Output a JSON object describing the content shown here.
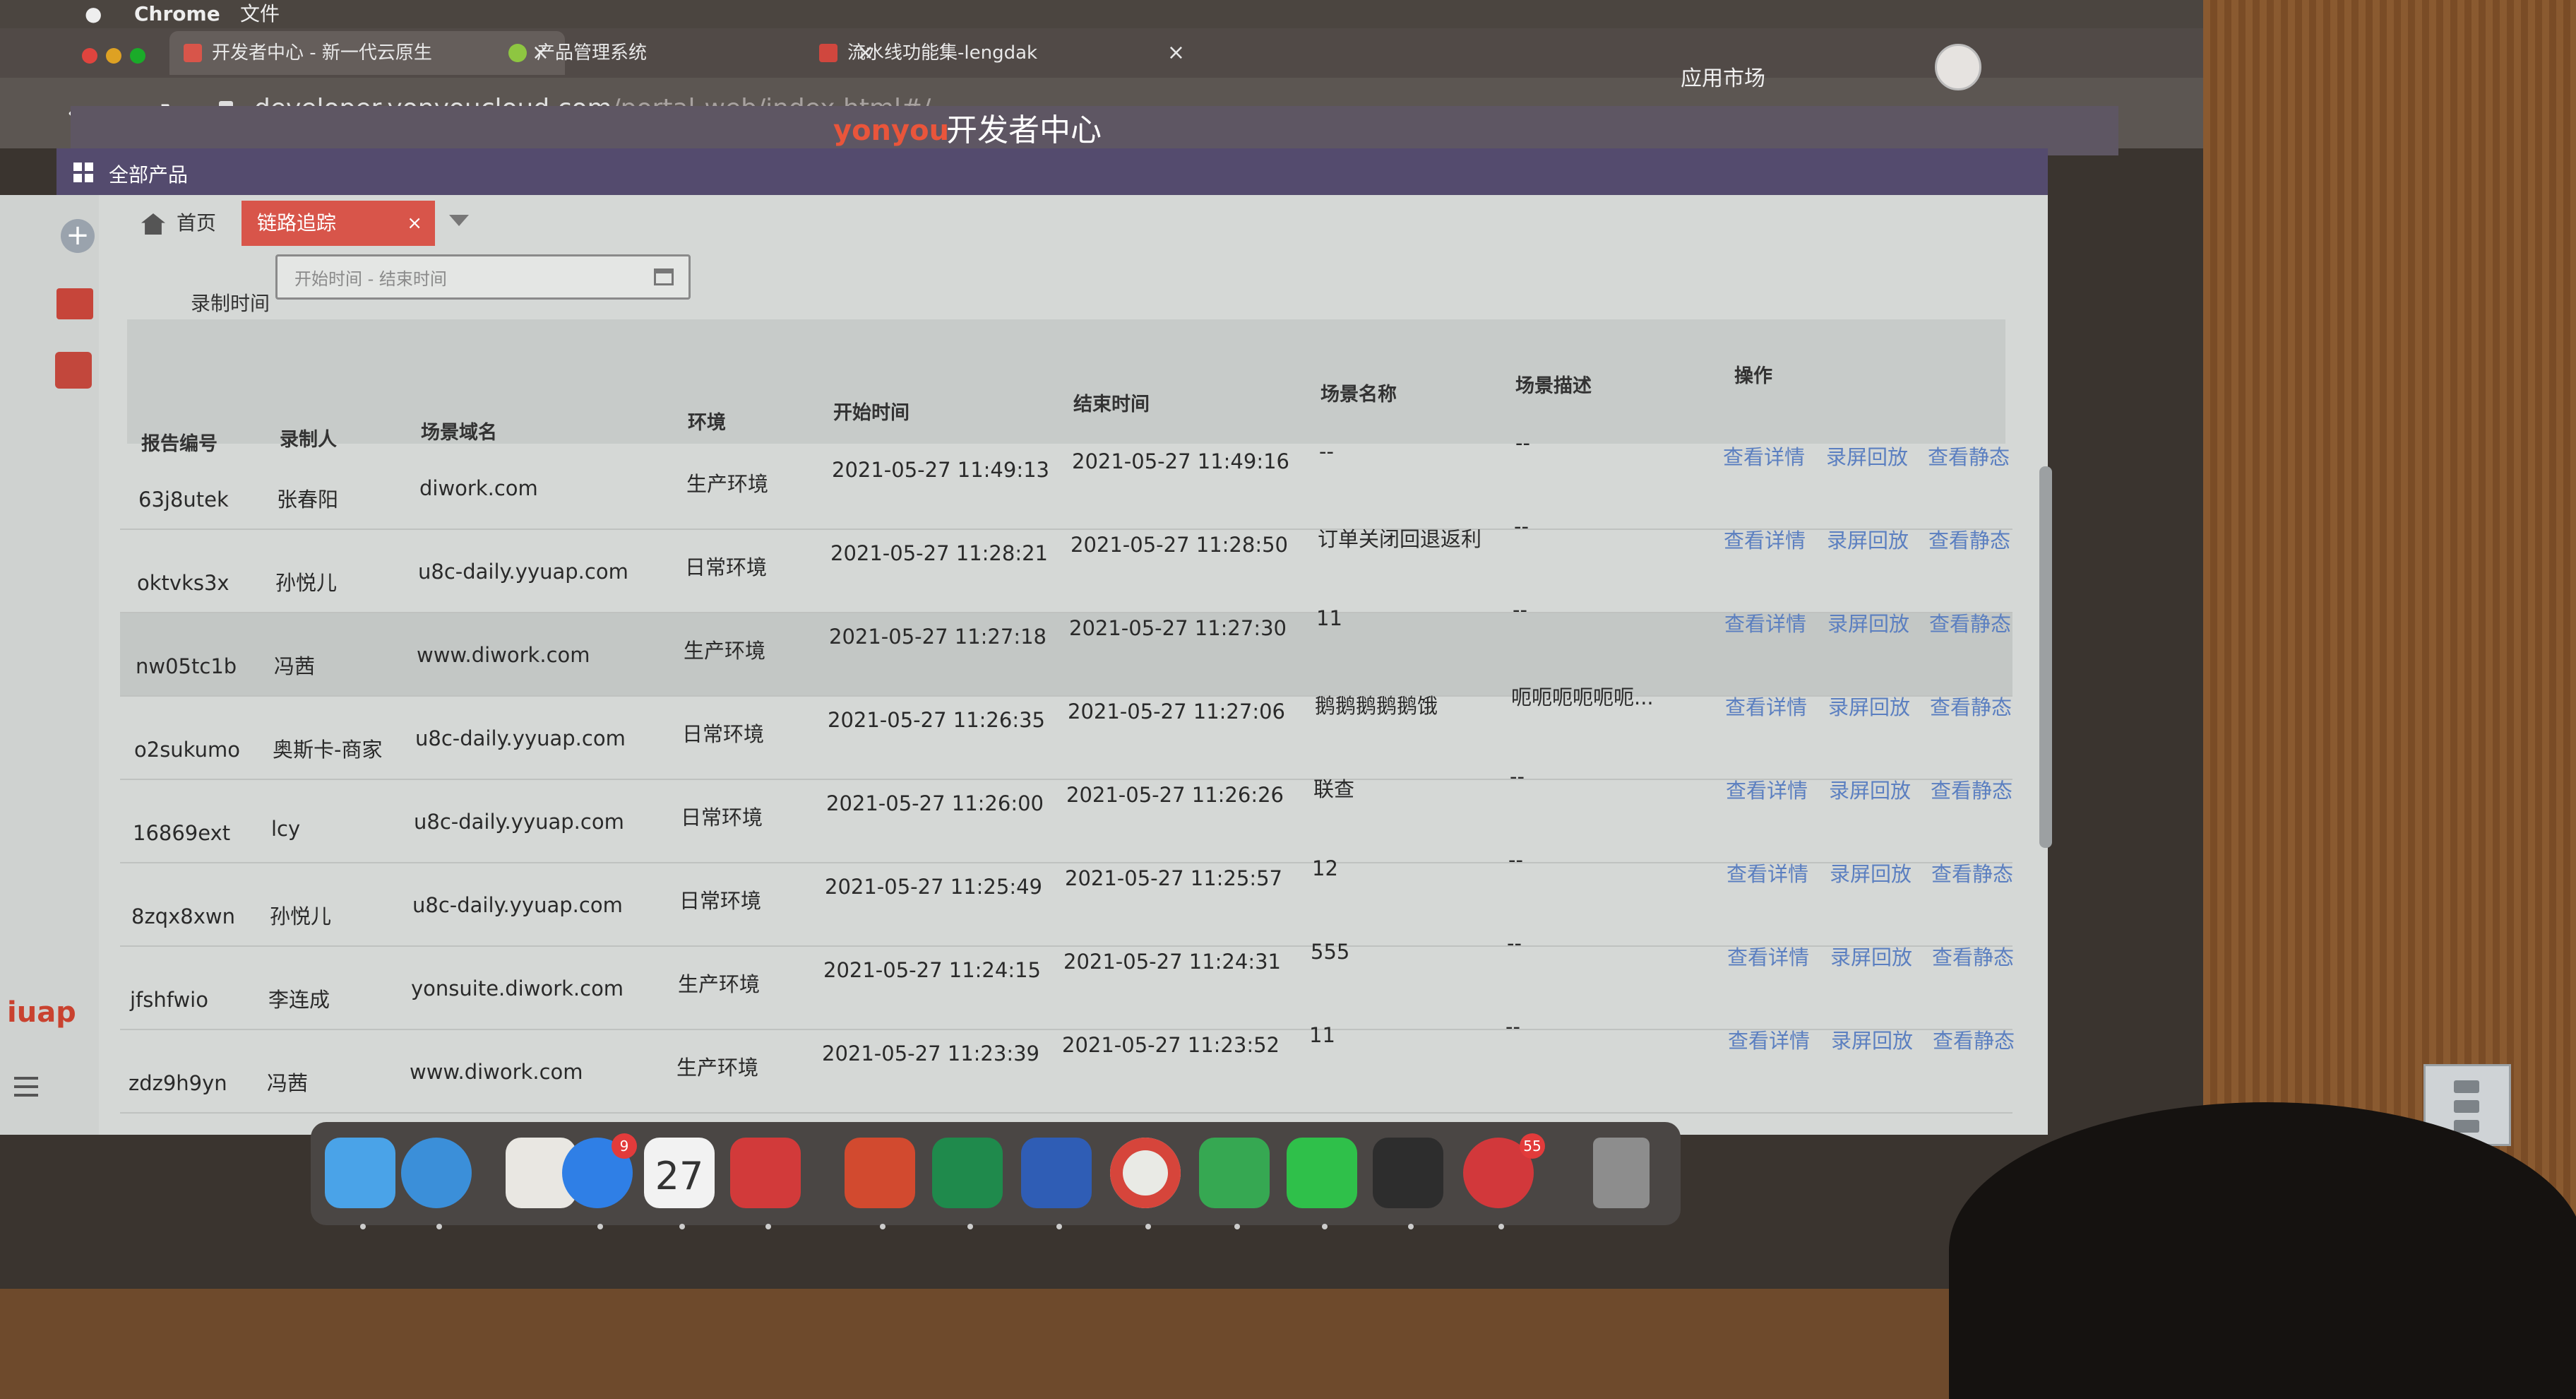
{
  "menubar": {
    "apple": "",
    "app": "Chrome",
    "menu1": "文件"
  },
  "browser": {
    "tabs": [
      {
        "label": "开发者中心 - 新一代云原生",
        "close": "×"
      },
      {
        "label": "产品管理系统",
        "close": "×"
      },
      {
        "label": "流水线功能集-lengdak",
        "close": "×"
      }
    ],
    "url_host": "developer.yonyoucloud.com",
    "url_path": "/portal-web/index.html#/",
    "nav": {
      "back": "←",
      "forward": "→",
      "reload": "↻"
    }
  },
  "app": {
    "logo": "yonyou",
    "title": "开发者中心",
    "market": "应用市场",
    "all_products": "全部产品",
    "iuap": "iuap"
  },
  "content_tabs": {
    "home": "首页",
    "active": "链路追踪",
    "close": "×"
  },
  "filter": {
    "label": "录制时间",
    "placeholder": "开始时间 - 结束时间"
  },
  "table": {
    "headers": [
      "报告编号",
      "录制人",
      "场景域名",
      "环境",
      "开始时间",
      "结束时间",
      "场景名称",
      "场景描述",
      "操作"
    ],
    "rows": [
      {
        "id": "63j8utek",
        "recorder": "张春阳",
        "domain": "diwork.com",
        "env": "生产环境",
        "start": "2021-05-27 11:49:13",
        "end": "2021-05-27 11:49:16",
        "scene": "--",
        "desc": "--"
      },
      {
        "id": "oktvks3x",
        "recorder": "孙悦儿",
        "domain": "u8c-daily.yyuap.com",
        "env": "日常环境",
        "start": "2021-05-27 11:28:21",
        "end": "2021-05-27 11:28:50",
        "scene": "订单关闭回退返利",
        "desc": "--"
      },
      {
        "id": "nw05tc1b",
        "recorder": "冯茜",
        "domain": "www.diwork.com",
        "env": "生产环境",
        "start": "2021-05-27 11:27:18",
        "end": "2021-05-27 11:27:30",
        "scene": "11",
        "desc": "--"
      },
      {
        "id": "o2sukumo",
        "recorder": "奥斯卡-商家",
        "domain": "u8c-daily.yyuap.com",
        "env": "日常环境",
        "start": "2021-05-27 11:26:35",
        "end": "2021-05-27 11:27:06",
        "scene": "鹅鹅鹅鹅鹅饿",
        "desc": "呃呃呃呃呃呃..."
      },
      {
        "id": "16869ext",
        "recorder": "lcy",
        "domain": "u8c-daily.yyuap.com",
        "env": "日常环境",
        "start": "2021-05-27 11:26:00",
        "end": "2021-05-27 11:26:26",
        "scene": "联查",
        "desc": "--"
      },
      {
        "id": "8zqx8xwn",
        "recorder": "孙悦儿",
        "domain": "u8c-daily.yyuap.com",
        "env": "日常环境",
        "start": "2021-05-27 11:25:49",
        "end": "2021-05-27 11:25:57",
        "scene": "12",
        "desc": "--"
      },
      {
        "id": "jfshfwio",
        "recorder": "李连成",
        "domain": "yonsuite.diwork.com",
        "env": "生产环境",
        "start": "2021-05-27 11:24:15",
        "end": "2021-05-27 11:24:31",
        "scene": "555",
        "desc": "--"
      },
      {
        "id": "zdz9h9yn",
        "recorder": "冯茜",
        "domain": "www.diwork.com",
        "env": "生产环境",
        "start": "2021-05-27 11:23:39",
        "end": "2021-05-27 11:23:52",
        "scene": "11",
        "desc": "--"
      }
    ],
    "actions": [
      "查看详情",
      "录屏回放",
      "查看静态"
    ]
  },
  "dock": {
    "badges": {
      "appstore": "9",
      "calendar_day": "27",
      "last_app": "55"
    }
  },
  "colors": {
    "accent_red": "#d8554a",
    "link_blue": "#5b7fc0",
    "header_purple": "#544b6e"
  }
}
